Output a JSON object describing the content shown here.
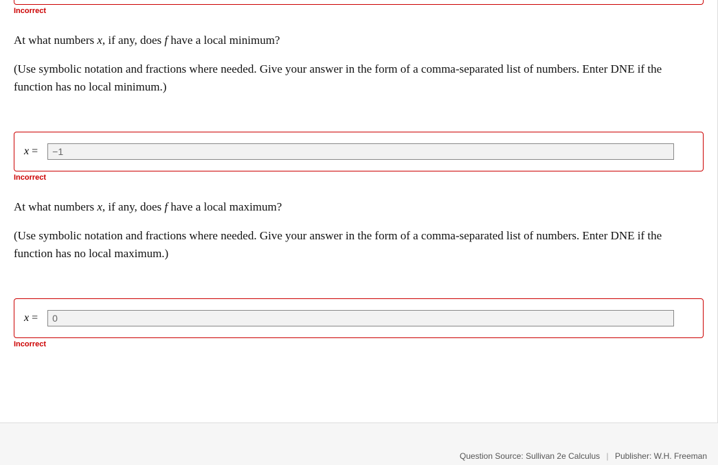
{
  "questions": [
    {
      "status": "Incorrect",
      "prompt_pre": "At what numbers ",
      "var": "x",
      "prompt_mid": ", if any, does ",
      "func": "f",
      "prompt_post": " have a local minimum?",
      "hint": "(Use symbolic notation and fractions where needed. Give your answer in the form of a comma-separated list of numbers. Enter DNE if the function has no local minimum.)",
      "prefix_var": "x",
      "prefix_eq": " =",
      "value": "−1",
      "result": "Incorrect"
    },
    {
      "prompt_pre": "At what numbers ",
      "var": "x",
      "prompt_mid": ", if any, does ",
      "func": "f",
      "prompt_post": " have a local maximum?",
      "hint": "(Use symbolic notation and fractions where needed. Give your answer in the form of a comma-separated list of numbers. Enter DNE if the function has no local maximum.)",
      "prefix_var": "x",
      "prefix_eq": " =",
      "value": "0",
      "result": "Incorrect"
    }
  ],
  "footer": {
    "source_label": "Question Source: ",
    "source_value": "Sullivan 2e Calculus",
    "publisher_label": "Publisher: ",
    "publisher_value": "W.H. Freeman"
  }
}
